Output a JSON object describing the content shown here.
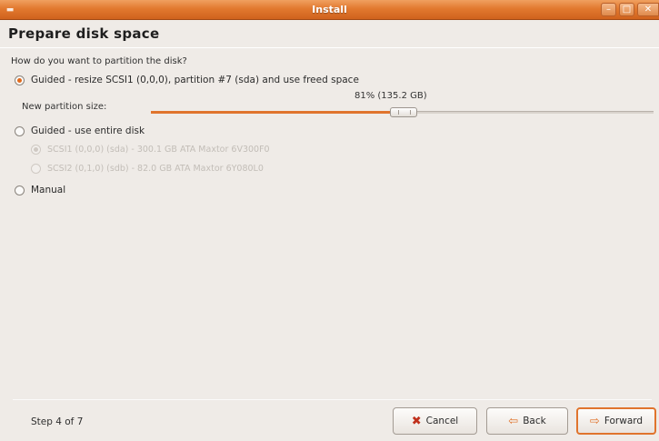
{
  "window": {
    "title": "Install",
    "menu_icon": "window-menu-icon",
    "controls": [
      "minimize-icon",
      "maximize-icon",
      "close-icon"
    ]
  },
  "page": {
    "title": "Prepare disk space",
    "question": "How do you want to partition the disk?"
  },
  "options": {
    "guided_resize": {
      "label": "Guided - resize SCSI1 (0,0,0), partition #7 (sda) and use freed space",
      "selected": true
    },
    "partition_size": {
      "label": "New partition size:",
      "value_label": "81% (135.2 GB)",
      "percent": 81
    },
    "guided_entire": {
      "label": "Guided - use entire disk",
      "selected": false
    },
    "disks": [
      {
        "label": "SCSI1 (0,0,0) (sda) - 300.1 GB ATA Maxtor 6V300F0",
        "selected": true,
        "enabled": false
      },
      {
        "label": "SCSI2 (0,1,0) (sdb) - 82.0 GB ATA Maxtor 6Y080L0",
        "selected": false,
        "enabled": false
      }
    ],
    "manual": {
      "label": "Manual",
      "selected": false
    }
  },
  "footer": {
    "step": "Step 4 of 7",
    "cancel_label": "Cancel",
    "back_label": "Back",
    "forward_label": "Forward",
    "cancel_icon": "cancel-icon",
    "back_icon": "back-arrow-icon",
    "forward_icon": "forward-arrow-icon"
  },
  "colors": {
    "accent": "#e0742d",
    "titlebar": "#e2792f",
    "window_bg": "#efebe7"
  }
}
